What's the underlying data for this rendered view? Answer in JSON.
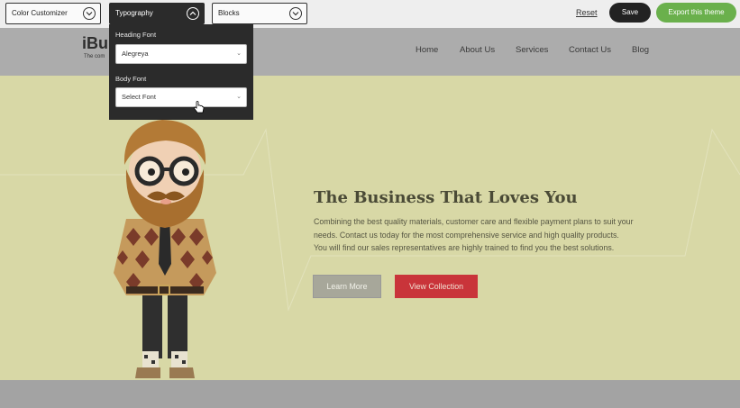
{
  "toolbar": {
    "color_customizer": "Color Customizer",
    "typography": "Typography",
    "blocks": "Blocks",
    "reset": "Reset",
    "save": "Save",
    "export": "Export this theme"
  },
  "typography_panel": {
    "heading_font_label": "Heading Font",
    "heading_font_value": "Alegreya",
    "body_font_label": "Body Font",
    "body_font_placeholder": "Select Font"
  },
  "site": {
    "logo": "iBu",
    "tagline": "The com",
    "nav": [
      "Home",
      "About Us",
      "Services",
      "Contact Us",
      "Blog"
    ]
  },
  "hero": {
    "title": "The Business That Loves You",
    "paragraph": [
      "Combining the best quality materials, customer care and flexible payment plans to suit your",
      "needs. Contact us today for the most comprehensive service and high quality products.",
      "You will find our sales representatives are highly trained to find you the best solutions."
    ],
    "learn_more": "Learn More",
    "view_collection": "View Collection"
  },
  "colors": {
    "toolbar_bg": "#eeeeee",
    "hero_bg": "#d8d8a6",
    "save_bg": "#222222",
    "export_bg": "#6ab04c",
    "collection_bg": "#c9343a",
    "panel_bg": "#2b2b2b"
  },
  "icons": {
    "dropdown_chevron": "chevron-down-icon",
    "dropdown_chevron_open": "chevron-up-icon",
    "select_caret": "caret-down-icon",
    "cursor": "hand-pointer-icon"
  }
}
